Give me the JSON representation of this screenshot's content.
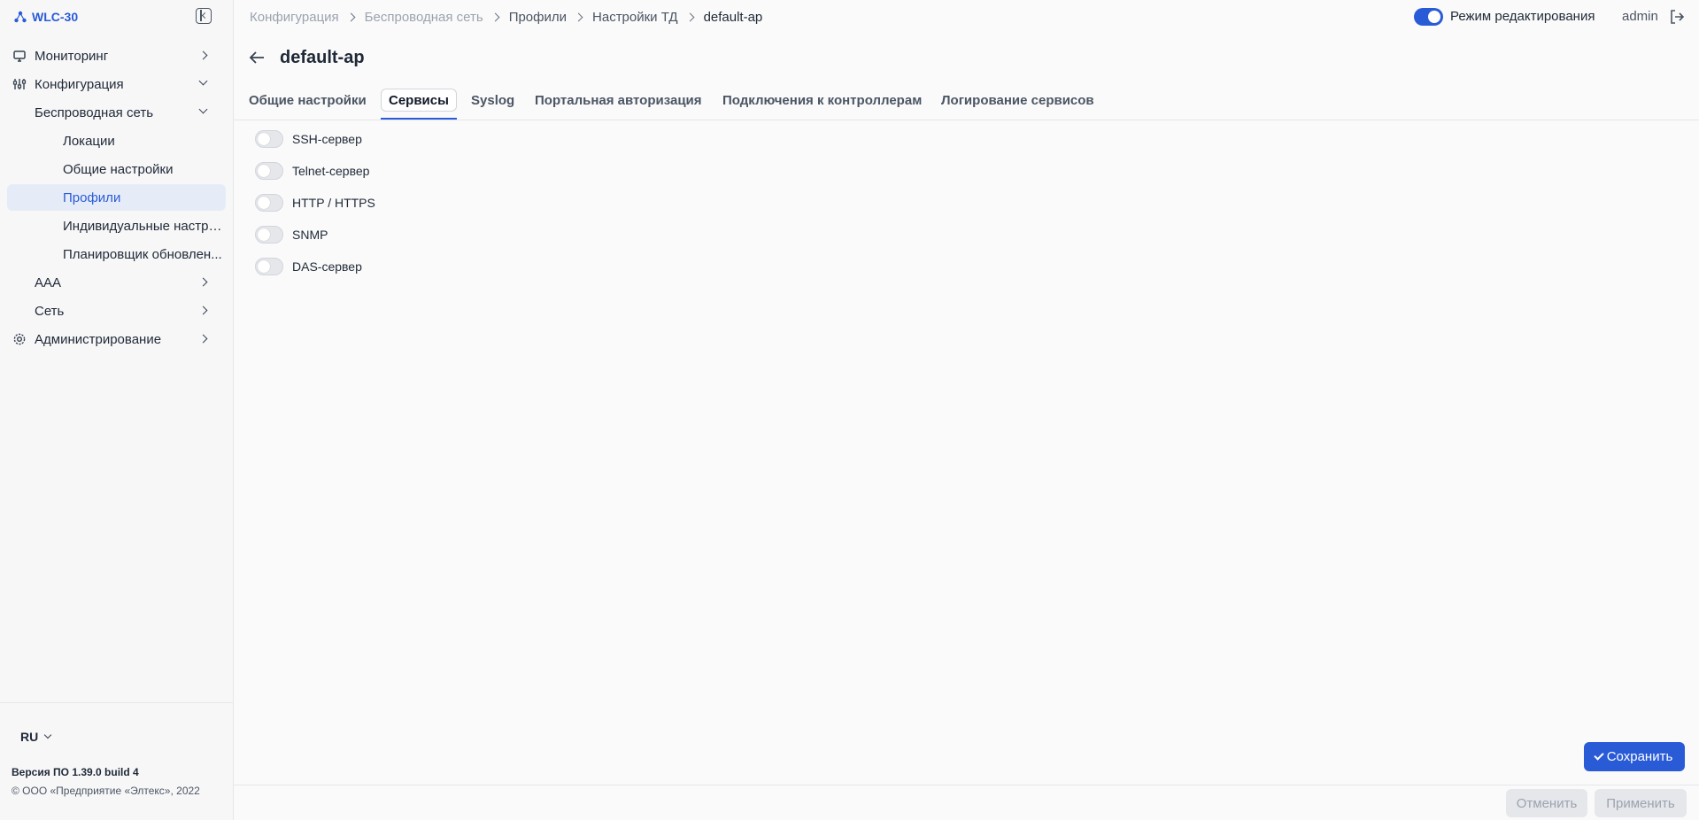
{
  "app": {
    "title": "WLC-30"
  },
  "sidebar": {
    "items": [
      {
        "label": "Мониторинг",
        "icon": "monitor-icon"
      },
      {
        "label": "Конфигурация",
        "icon": "sliders-icon"
      },
      {
        "label": "Беспроводная сеть"
      },
      {
        "label": "Локации"
      },
      {
        "label": "Общие настройки"
      },
      {
        "label": "Профили"
      },
      {
        "label": "Индивидуальные настро..."
      },
      {
        "label": "Планировщик обновлен..."
      },
      {
        "label": "AAA"
      },
      {
        "label": "Сеть"
      },
      {
        "label": "Администрирование",
        "icon": "gear-icon"
      }
    ],
    "language": "RU",
    "version": "Версия ПО 1.39.0 build 4",
    "copyright": "© ООО «Предприятие «Элтекс», 2022"
  },
  "breadcrumb": [
    "Конфигурация",
    "Беспроводная сеть",
    "Профили",
    "Настройки ТД",
    "default-ap"
  ],
  "header": {
    "edit_mode_label": "Режим редактирования",
    "edit_mode_on": true,
    "user": "admin"
  },
  "page": {
    "title": "default-ap",
    "tabs": [
      "Общие настройки",
      "Сервисы",
      "Syslog",
      "Портальная авторизация",
      "Подключения к контроллерам",
      "Логирование сервисов"
    ],
    "active_tab": "Сервисы",
    "services": [
      {
        "label": "SSH-сервер",
        "enabled": false
      },
      {
        "label": "Telnet-сервер",
        "enabled": false
      },
      {
        "label": "HTTP / HTTPS",
        "enabled": false
      },
      {
        "label": "SNMP",
        "enabled": false
      },
      {
        "label": "DAS-сервер",
        "enabled": false
      }
    ]
  },
  "actions": {
    "save": "Сохранить",
    "cancel": "Отменить",
    "apply": "Применить"
  },
  "colors": {
    "accent": "#2a5bd7",
    "active_bg": "#e6ecf7"
  }
}
